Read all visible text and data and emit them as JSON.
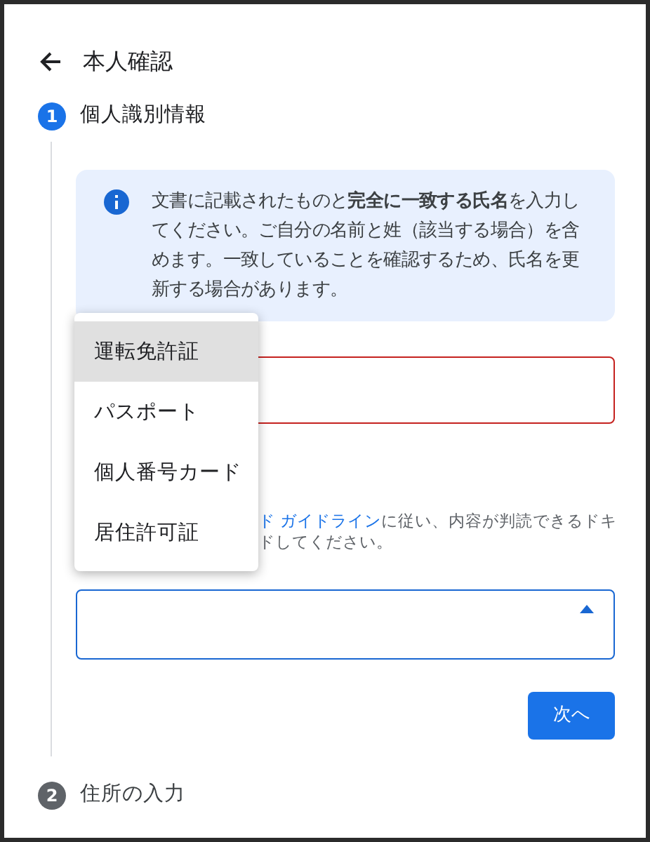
{
  "header": {
    "title": "本人確認"
  },
  "steps": [
    {
      "number": "1",
      "title": "個人識別情報",
      "active": true
    },
    {
      "number": "2",
      "title": "住所の入力",
      "active": false
    }
  ],
  "info": {
    "text": "文書に記載されたものと**完全に一致する氏名**を入力してください。ご自分の名前と姓（該当する場合）を含めます。一致していることを確認するため、氏名を更新する場合があります。"
  },
  "name_field": {
    "error": true
  },
  "hint": {
    "lines": [
      {
        "link": "ド ガイドライン",
        "text": "に従い、内容が判読できるドキ"
      },
      {
        "text": "ドしてください。"
      }
    ]
  },
  "id_select": {
    "expanded": true
  },
  "menu": [
    {
      "label": "運転免許証",
      "selected": true
    },
    {
      "label": "パスポート",
      "selected": false
    },
    {
      "label": "個人番号カード",
      "selected": false
    },
    {
      "label": "居住許可証",
      "selected": false
    }
  ],
  "next_button": {
    "label": "次へ"
  }
}
